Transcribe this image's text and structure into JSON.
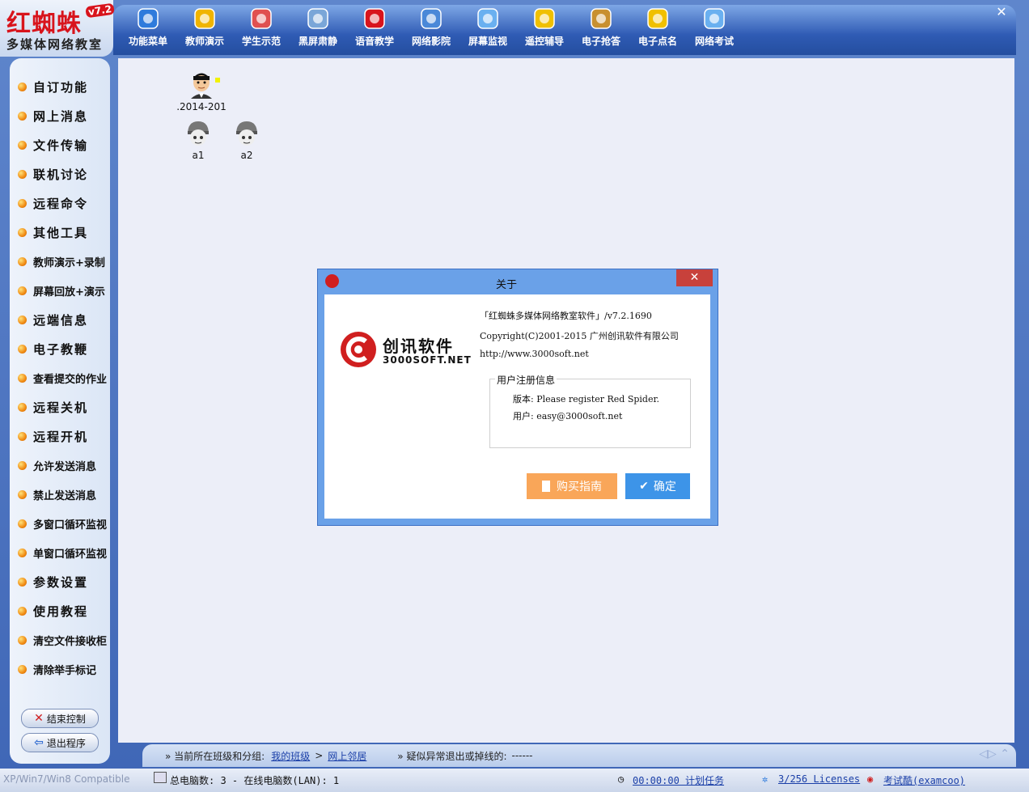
{
  "app": {
    "title": "红蜘蛛",
    "version_badge": "v7.2",
    "subtitle": "多媒体网络教室",
    "close_glyph": "✕"
  },
  "toolbar": {
    "buttons": [
      {
        "label": "功能菜单",
        "icon": "gear-icon",
        "color": "#2f7bdc"
      },
      {
        "label": "教师演示",
        "icon": "teacher-icon",
        "color": "#f0b400"
      },
      {
        "label": "学生示范",
        "icon": "students-icon",
        "color": "#e05050"
      },
      {
        "label": "黑屏肃静",
        "icon": "monitor-icon",
        "color": "#7aa6d8"
      },
      {
        "label": "语音教学",
        "icon": "megaphone-icon",
        "color": "#d8141c"
      },
      {
        "label": "网络影院",
        "icon": "film-icon",
        "color": "#4a88d8"
      },
      {
        "label": "屏幕监视",
        "icon": "screen-icon",
        "color": "#6ab0f0"
      },
      {
        "label": "遥控辅导",
        "icon": "satellite-icon",
        "color": "#f0c000"
      },
      {
        "label": "电子抢答",
        "icon": "document-icon",
        "color": "#c89030"
      },
      {
        "label": "电子点名",
        "icon": "rollcall-icon",
        "color": "#f0c000"
      },
      {
        "label": "网络考试",
        "icon": "computer-icon",
        "color": "#6ab0f0"
      }
    ]
  },
  "sidebar": {
    "items": [
      {
        "label": "自订功能",
        "small": false
      },
      {
        "label": "网上消息",
        "small": false
      },
      {
        "label": "文件传输",
        "small": false
      },
      {
        "label": "联机讨论",
        "small": false
      },
      {
        "label": "远程命令",
        "small": false
      },
      {
        "label": "其他工具",
        "small": false
      },
      {
        "label": "教师演示+录制",
        "small": true
      },
      {
        "label": "屏幕回放+演示",
        "small": true
      },
      {
        "label": "远端信息",
        "small": false
      },
      {
        "label": "电子教鞭",
        "small": false
      },
      {
        "label": "查看提交的作业",
        "small": true
      },
      {
        "label": "远程关机",
        "small": false
      },
      {
        "label": "远程开机",
        "small": false
      },
      {
        "label": "允许发送消息",
        "small": true
      },
      {
        "label": "禁止发送消息",
        "small": true
      },
      {
        "label": "多窗口循环监视",
        "small": true
      },
      {
        "label": "单窗口循环监视",
        "small": true
      },
      {
        "label": "参数设置",
        "small": false
      },
      {
        "label": "使用教程",
        "small": false
      },
      {
        "label": "清空文件接收柜",
        "small": true
      },
      {
        "label": "清除举手标记",
        "small": true
      }
    ],
    "end_control": "结束控制",
    "exit_program": "退出程序"
  },
  "students": [
    {
      "name": ".2014-201",
      "type": "teacher"
    },
    {
      "name": "a1",
      "type": "student"
    },
    {
      "name": "a2",
      "type": "student"
    }
  ],
  "pathbar": {
    "prefix": "» 当前所在班级和分组:",
    "class_link": "我的班级",
    "sep": ">",
    "group_link": "网上邻居",
    "abnormal_label": "» 疑似异常退出或掉线的:",
    "abnormal_value": "------"
  },
  "statusbar": {
    "compat": "XP/Win7/Win8 Compatible",
    "total": "总电脑数: 3  -  在线电脑数(LAN): 1",
    "timer": "00:00:00 计划任务",
    "licenses": "3/256 Licenses",
    "exam": "考试酷(examcoo)"
  },
  "dialog": {
    "title": "关于",
    "close_glyph": "✕",
    "brand_cn": "创讯软件",
    "brand_en": "3000SOFT.NET",
    "product": "「红蜘蛛多媒体网络教室软件」/v7.2.1690",
    "copyright": "Copyright(C)2001-2015 广州创讯软件有限公司",
    "url": "http://www.3000soft.net",
    "reg_group": "用户注册信息",
    "version_label": "版本: Please register Red Spider.",
    "user_label": "用户: easy@3000soft.net",
    "buy_button": "购买指南",
    "ok_button": "确定"
  }
}
